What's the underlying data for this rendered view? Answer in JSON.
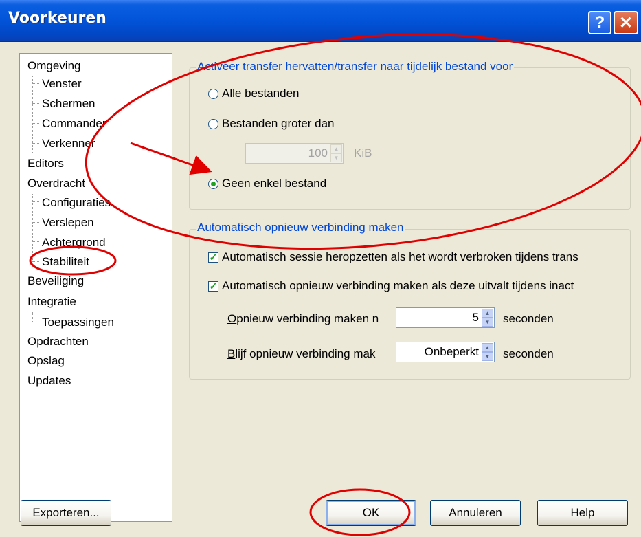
{
  "window": {
    "title": "Voorkeuren",
    "help_glyph": "?",
    "close_glyph": "✕"
  },
  "tree": {
    "items": [
      {
        "label": "Omgeving",
        "level": 0
      },
      {
        "label": "Venster",
        "level": 1
      },
      {
        "label": "Schermen",
        "level": 1
      },
      {
        "label": "Commander",
        "level": 1
      },
      {
        "label": "Verkenner",
        "level": 1
      },
      {
        "label": "Editors",
        "level": 0
      },
      {
        "label": "Overdracht",
        "level": 0
      },
      {
        "label": "Configuraties",
        "level": 1
      },
      {
        "label": "Verslepen",
        "level": 1
      },
      {
        "label": "Achtergrond",
        "level": 1
      },
      {
        "label": "Stabiliteit",
        "level": 1,
        "selected": true
      },
      {
        "label": "Beveiliging",
        "level": 0
      },
      {
        "label": "Integratie",
        "level": 0
      },
      {
        "label": "Toepassingen",
        "level": 1
      },
      {
        "label": "Opdrachten",
        "level": 0
      },
      {
        "label": "Opslag",
        "level": 0
      },
      {
        "label": "Updates",
        "level": 0
      }
    ]
  },
  "resume_group": {
    "title": "Activeer transfer hervatten/transfer naar tijdelijk bestand voor",
    "option_all": "Alle bestanden",
    "option_larger": "Bestanden groter dan",
    "size_value": "100",
    "size_unit": "KiB",
    "option_none": "Geen enkel bestand",
    "selected": "Geen enkel bestand"
  },
  "reconnect_group": {
    "title": "Automatisch opnieuw verbinding maken",
    "check_session": "Automatisch sessie heropzetten als het wordt verbroken tijdens trans",
    "check_session_checked": true,
    "check_idle": "Automatisch opnieuw verbinding maken als deze uitvalt tijdens inact",
    "check_idle_checked": true,
    "delay_label": "Opnieuw verbinding maken n",
    "delay_value": "5",
    "delay_unit": "seconden",
    "keep_label": "Blijf opnieuw verbinding mak",
    "keep_value": "Onbeperkt",
    "keep_unit": "seconden"
  },
  "buttons": {
    "export": "Exporteren...",
    "ok": "OK",
    "cancel": "Annuleren",
    "help": "Help"
  },
  "colors": {
    "annotation": "#e00000",
    "group_title": "#0046d5",
    "titlebar": "#0253d8"
  }
}
